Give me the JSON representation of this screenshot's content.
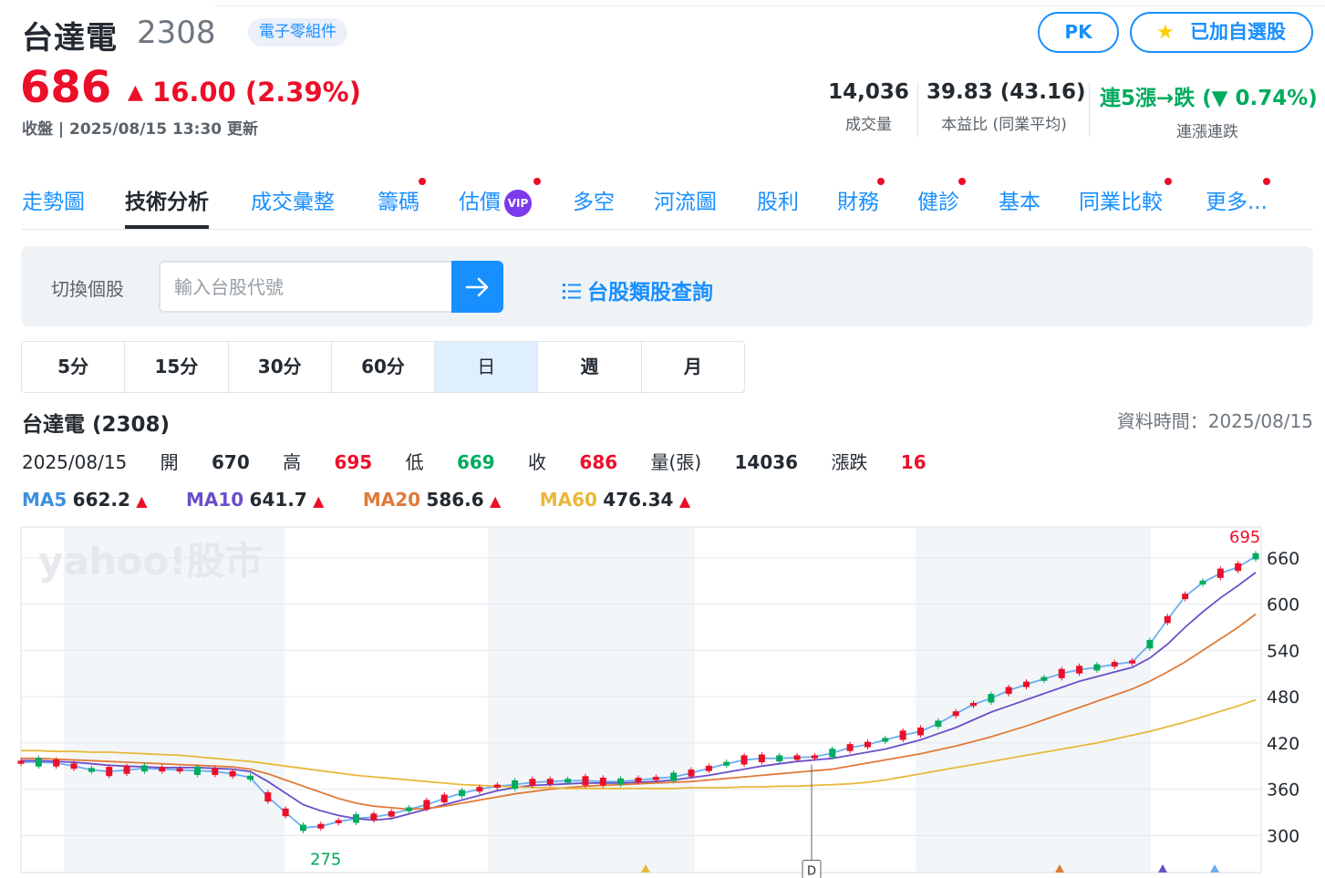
{
  "header": {
    "name": "台達電",
    "code": "2308",
    "sector_tag": "電子零組件",
    "pk_label": "PK",
    "watchlist_label": "已加自選股",
    "price": "686",
    "change": "16.00 (2.39%)",
    "update": "收盤 | 2025/08/15 13:30 更新",
    "stats": [
      {
        "value": "14,036",
        "label": "成交量"
      },
      {
        "value": "39.83 (43.16)",
        "label": "本益比 (同業平均)"
      },
      {
        "value": "連5漲→跌 (▼ 0.74%)",
        "label": "連漲連跌"
      }
    ]
  },
  "tabs": [
    "走勢圖",
    "技術分析",
    "成交彙整",
    "籌碼",
    "估價",
    "多空",
    "河流圖",
    "股利",
    "財務",
    "健診",
    "基本",
    "同業比較",
    "更多..."
  ],
  "vip_label": "VIP",
  "switcher": {
    "label": "切換個股",
    "placeholder": "輸入台股代號",
    "sector_link": "台股類股查詢"
  },
  "periods": [
    "5分",
    "15分",
    "30分",
    "60分",
    "日",
    "週",
    "月"
  ],
  "chart_header": {
    "title": "台達電 (2308)",
    "data_time": "資料時間：2025/08/15",
    "date": "2025/08/15",
    "open_label": "開",
    "open": "670",
    "high_label": "高",
    "high": "695",
    "low_label": "低",
    "low": "669",
    "close_label": "收",
    "close": "686",
    "volume_label": "量(張)",
    "volume": "14036",
    "change_label": "漲跌",
    "change": "16"
  },
  "ma": [
    {
      "label": "MA5",
      "value": "662.2",
      "color": "#3d8fe0"
    },
    {
      "label": "MA10",
      "value": "641.7",
      "color": "#6a4fc9"
    },
    {
      "label": "MA20",
      "value": "586.6",
      "color": "#e07a38"
    },
    {
      "label": "MA60",
      "value": "476.34",
      "color": "#e8b83a"
    }
  ],
  "colors": {
    "up": "#eb0f29",
    "down": "#00ab5e",
    "link": "#188fff"
  },
  "chart_data": {
    "type": "line",
    "watermark": "yahoo!股市",
    "y_ticks": [
      660,
      600,
      540,
      480,
      420,
      360,
      300
    ],
    "ylim": [
      252,
      700
    ],
    "high_label": "695",
    "low_label": "275",
    "event_marker": "D",
    "series": [
      {
        "name": "MA5",
        "values": [
          395,
          395,
          394,
          390,
          385,
          383,
          385,
          387,
          386,
          385,
          384,
          383,
          380,
          375,
          350,
          330,
          310,
          312,
          318,
          322,
          324,
          328,
          334,
          340,
          348,
          355,
          360,
          364,
          366,
          369,
          370,
          371,
          371,
          370,
          370,
          372,
          374,
          376,
          381,
          387,
          393,
          398,
          400,
          400,
          401,
          402,
          407,
          414,
          418,
          424,
          430,
          435,
          445,
          458,
          470,
          478,
          488,
          496,
          503,
          510,
          515,
          518,
          522,
          525,
          548,
          580,
          610,
          628,
          640,
          648,
          662
        ]
      },
      {
        "name": "MA10",
        "values": [
          397,
          397,
          396,
          395,
          393,
          391,
          390,
          389,
          388,
          388,
          388,
          387,
          386,
          383,
          370,
          355,
          340,
          332,
          326,
          322,
          320,
          322,
          328,
          334,
          340,
          346,
          352,
          358,
          362,
          365,
          366,
          367,
          368,
          368,
          368,
          369,
          370,
          372,
          375,
          378,
          382,
          386,
          390,
          393,
          396,
          398,
          400,
          404,
          408,
          412,
          418,
          424,
          432,
          440,
          450,
          460,
          468,
          476,
          484,
          492,
          500,
          506,
          512,
          518,
          530,
          548,
          570,
          590,
          608,
          624,
          641
        ]
      },
      {
        "name": "MA20",
        "values": [
          400,
          400,
          399,
          398,
          397,
          396,
          395,
          394,
          393,
          392,
          391,
          390,
          389,
          386,
          380,
          372,
          364,
          356,
          348,
          342,
          338,
          336,
          334,
          335,
          338,
          342,
          346,
          350,
          354,
          357,
          360,
          362,
          364,
          365,
          366,
          367,
          368,
          369,
          370,
          372,
          374,
          376,
          378,
          380,
          382,
          384,
          386,
          390,
          394,
          398,
          402,
          406,
          411,
          416,
          422,
          428,
          435,
          442,
          450,
          458,
          466,
          474,
          482,
          490,
          500,
          512,
          525,
          540,
          555,
          570,
          587
        ]
      },
      {
        "name": "MA60",
        "values": [
          410,
          410,
          409,
          409,
          408,
          408,
          407,
          406,
          405,
          404,
          402,
          400,
          398,
          396,
          393,
          390,
          387,
          384,
          381,
          378,
          376,
          374,
          372,
          370,
          368,
          366,
          365,
          364,
          363,
          362,
          362,
          361,
          361,
          361,
          361,
          361,
          361,
          361,
          362,
          362,
          362,
          363,
          363,
          364,
          364,
          365,
          366,
          367,
          369,
          372,
          376,
          380,
          384,
          388,
          392,
          396,
          400,
          404,
          408,
          412,
          416,
          420,
          425,
          430,
          435,
          441,
          447,
          454,
          461,
          468,
          476
        ]
      }
    ]
  }
}
